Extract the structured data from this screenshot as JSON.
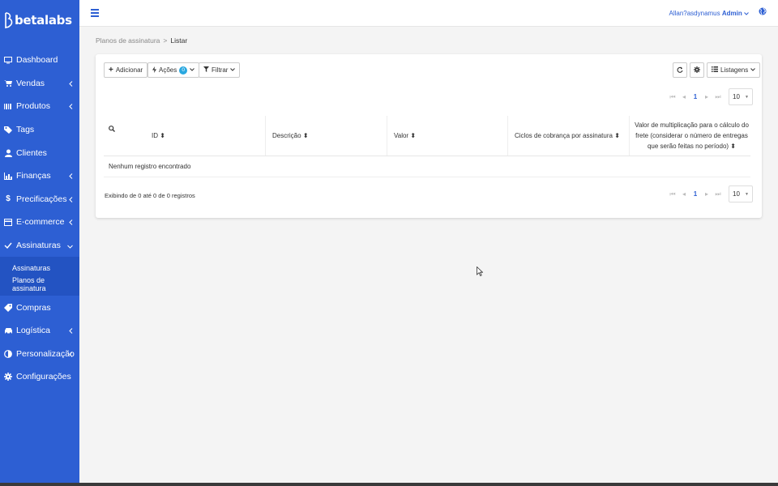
{
  "brand": {
    "name": "betalabs"
  },
  "topbar": {
    "user_prefix": "Allan?asdynamus",
    "user_role": "Admin"
  },
  "sidebar": {
    "items": [
      {
        "label": "Dashboard",
        "icon": "monitor-icon",
        "has_arrow": false
      },
      {
        "label": "Vendas",
        "icon": "cart-icon",
        "has_arrow": true
      },
      {
        "label": "Produtos",
        "icon": "barcode-icon",
        "has_arrow": true
      },
      {
        "label": "Tags",
        "icon": "tags-icon",
        "has_arrow": false
      },
      {
        "label": "Clientes",
        "icon": "user-icon",
        "has_arrow": false
      },
      {
        "label": "Finanças",
        "icon": "bar-chart-icon",
        "has_arrow": true
      },
      {
        "label": "Precificações",
        "icon": "dollar-icon",
        "has_arrow": true
      },
      {
        "label": "E-commerce",
        "icon": "storefront-icon",
        "has_arrow": true
      },
      {
        "label": "Assinaturas",
        "icon": "check-icon",
        "has_arrow": true,
        "open": true
      },
      {
        "label": "Compras",
        "icon": "tag-icon",
        "has_arrow": false
      },
      {
        "label": "Logística",
        "icon": "car-icon",
        "has_arrow": true
      },
      {
        "label": "Personalização",
        "icon": "contrast-icon",
        "has_arrow": true
      },
      {
        "label": "Configurações",
        "icon": "gear-icon",
        "has_arrow": false
      }
    ],
    "submenu": [
      "Assinaturas",
      "Planos de assinatura"
    ]
  },
  "breadcrumb": {
    "parent": "Planos de assinatura",
    "separator": ">",
    "current": "Listar"
  },
  "toolbar": {
    "add_label": "Adicionar",
    "actions_label": "Ações",
    "actions_count": "0",
    "filter_label": "Filtrar",
    "listings_label": "Listagens"
  },
  "pagination": {
    "current_page": "1",
    "page_size": "10"
  },
  "table": {
    "columns": [
      "ID",
      "Descrição",
      "Valor",
      "Ciclos de cobrança por assinatura",
      "Valor de multiplicação para o cálculo do frete (considerar o número de entregas que serão feitas no período)"
    ],
    "empty_message": "Nenhum registro encontrado",
    "footer": "Exibindo de 0 até 0 de 0 registros"
  },
  "colors": {
    "sidebar": "#2d5fd3",
    "accent": "#2d5fd3",
    "badge": "#29a8e0"
  }
}
